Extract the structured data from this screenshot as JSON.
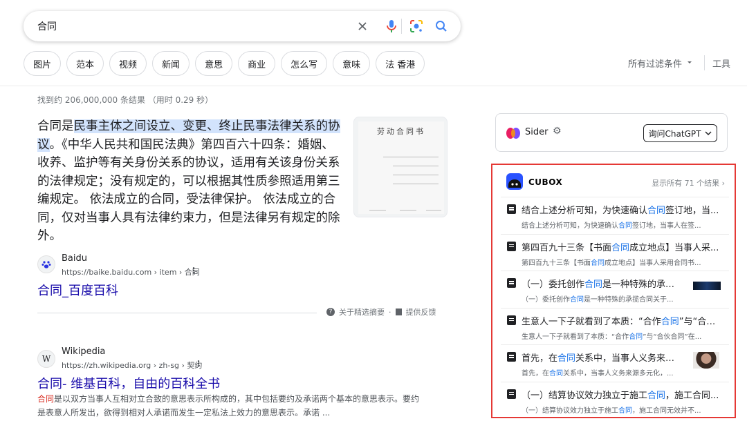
{
  "search": {
    "query": "合同"
  },
  "colors": {
    "link": "#1a0dab",
    "highlight": "#d2e3fc",
    "cubox_border": "#e53935",
    "cubox_brand": "#2952ff"
  },
  "chips": [
    "图片",
    "范本",
    "视频",
    "新闻",
    "意思",
    "商业",
    "怎么写",
    "意味",
    "法 香港"
  ],
  "toolbar": {
    "filters_label": "所有过滤条件",
    "tools_label": "工具"
  },
  "stats": "找到约 206,000,000 条结果 （用时 0.29 秒）",
  "snippet": {
    "highlight": "民事主体之间设立、变更、终止民事法律关系的协议",
    "before": "合同是",
    "after": "。《中华人民共和国民法典》第四百六十四条：婚姻、收养、监护等有关身份关系的协议，适用有关该身份关系的法律规定；没有规定的，可以根据其性质参照适用第三编规定。 依法成立的合同，受法律保护。 依法成立的合同，仅对当事人具有法律约束力，但是法律另有规定的除外。",
    "thumb_title": "劳动合同书",
    "thumb_icon": "document-thumbnail"
  },
  "result1": {
    "site": "Baidu",
    "url": "https://baike.baidu.com › item › 合同",
    "title": "合同_百度百科",
    "icon": "baidu-paw-icon"
  },
  "feedback": {
    "about": "关于精选摘要",
    "sep": "·",
    "report": "提供反馈"
  },
  "result2": {
    "site": "Wikipedia",
    "favicon_letter": "W",
    "url": "https://zh.wikipedia.org › zh-sg › 契约",
    "title": "合同- 维基百科，自由的百科全书",
    "snippet_em": "合同",
    "snippet_rest": "是以双方当事人互相对立合致的意思表示所构成的，其中包括要约及承诺两个基本的意思表示。要约是表意人所发出，欲得到相对人承诺而发生一定私法上效力的意思表示。承诺 ..."
  },
  "sider": {
    "name": "Sider",
    "ask_label": "询问ChatGPT"
  },
  "cubox": {
    "title": "CUBOX",
    "show_all": "显示所有 71 个结果",
    "items": [
      {
        "t1": "结合上述分析可知，为快速确认",
        "tk": "合同",
        "t2": "签订地，当...",
        "s1": "结合上述分析可知，为快速确认",
        "sk": "合同",
        "s2": "签订地，当事人在签...",
        "img": ""
      },
      {
        "t1": "第四百九十三条【书面",
        "tk": "合同",
        "t2": "成立地点】当事人采...",
        "s1": "第四百九十三条【书面",
        "sk": "合同",
        "s2": "成立地点】当事人采用合同书...",
        "img": ""
      },
      {
        "t1": "（一）委托创作",
        "tk": "合同",
        "t2": "是一种特殊的承揽合...",
        "s1": "（一）委托创作",
        "sk": "合同",
        "s2": "是一种特殊的承揽合同关于...",
        "img": "dark-banner"
      },
      {
        "t1": "生意人一下子就看到了本质：“合作",
        "tk": "合同",
        "t2": "”与“合伙...",
        "s1": "生意人一下子就看到了本质：“合作",
        "sk": "合同",
        "s2": "”与“合伙合同”在...",
        "img": ""
      },
      {
        "t1": "首先，在",
        "tk": "合同",
        "t2": "关系中，当事人义务来源多...",
        "s1": "首先，在",
        "sk": "合同",
        "s2": "关系中，当事人义务来源多元化，...",
        "img": "portrait"
      },
      {
        "t1": "（一）结算协议效力独立于施工",
        "tk": "合同",
        "t2": "，施工合同...",
        "s1": "（一）结算协议效力独立于施工",
        "sk": "合同",
        "s2": "，施工合同无效并不...",
        "img": ""
      }
    ]
  }
}
